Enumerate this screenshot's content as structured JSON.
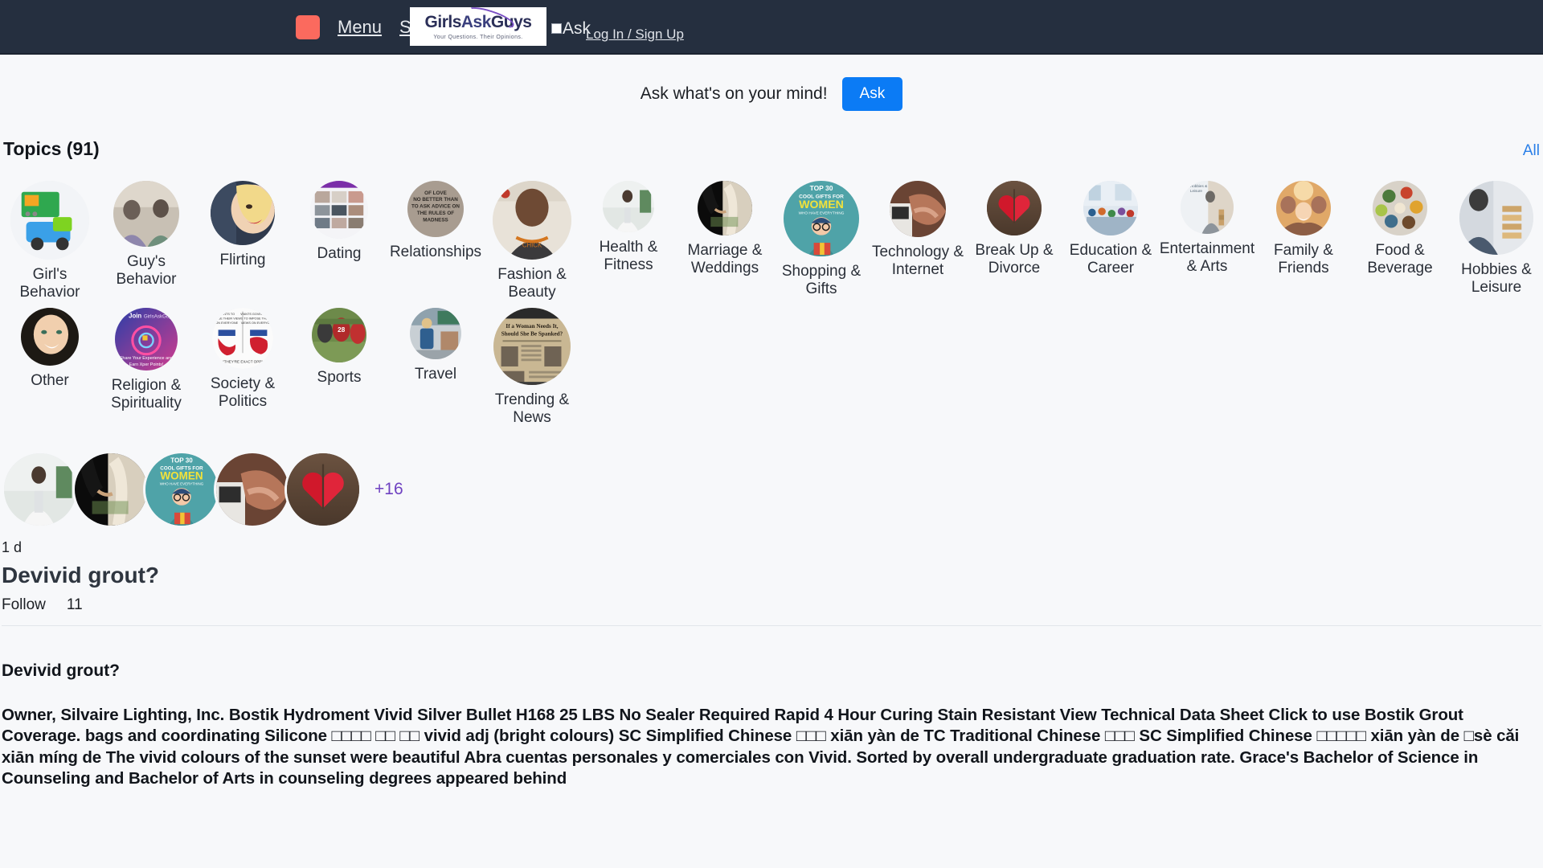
{
  "header": {
    "menu_icon": "hamburger-square-icon",
    "menu_label": "Menu",
    "search_label": "Search",
    "logo": {
      "part1": "Girls",
      "part2": "Ask",
      "part3": "Guys",
      "tagline": "Your Questions. Their Opinions."
    },
    "ask_checkbox_label": "Ask",
    "login_label": "Log In / Sign Up",
    "bar_color": "#252f3f",
    "menu_icon_color": "#fb6a5e"
  },
  "askbar": {
    "prompt": "Ask what's on your mind!",
    "button_label": "Ask",
    "button_color": "#0b7bf5"
  },
  "topics": {
    "title": "Topics (91)",
    "all_label": "All",
    "all_color": "#2a7fe8",
    "row1": [
      {
        "label": "Girl's Behavior",
        "size": 98,
        "art": "toys"
      },
      {
        "label": "Guy's Behavior",
        "size": 82,
        "art": "guys"
      },
      {
        "label": "Flirting",
        "size": 80,
        "art": "flirt"
      },
      {
        "label": "Dating",
        "size": 72,
        "art": "dating"
      },
      {
        "label": "Relationships",
        "size": 70,
        "art": "relationships"
      },
      {
        "label": "Fashion & Beauty",
        "size": 98,
        "art": "fashion"
      },
      {
        "label": "Health & Fitness",
        "size": 64,
        "art": "health"
      },
      {
        "label": "Marriage & Weddings",
        "size": 68,
        "art": "marriage"
      },
      {
        "label": "Shopping & Gifts",
        "size": 94,
        "art": "shopping"
      },
      {
        "label": "Technology & Internet",
        "size": 70,
        "art": "tech"
      },
      {
        "label": "Break Up & Divorce",
        "size": 68,
        "art": "breakup"
      },
      {
        "label": "Education & Career",
        "size": 68,
        "art": "education"
      },
      {
        "label": "Entertainment & Arts",
        "size": 66,
        "art": "entertainment"
      },
      {
        "label": "Family & Friends",
        "size": 68,
        "art": "family"
      },
      {
        "label": "Food & Beverage",
        "size": 68,
        "art": "food"
      },
      {
        "label": "Hobbies & Leisure",
        "size": 92,
        "art": "hobbies"
      }
    ],
    "row2": [
      {
        "label": "Other",
        "size": 72,
        "art": "other"
      },
      {
        "label": "Religion & Spirituality",
        "size": 78,
        "art": "religion"
      },
      {
        "label": "Society & Politics",
        "size": 76,
        "art": "politics"
      },
      {
        "label": "Sports",
        "size": 68,
        "art": "sports"
      },
      {
        "label": "Travel",
        "size": 64,
        "art": "travel"
      },
      {
        "label": "Trending & News",
        "size": 96,
        "art": "trending"
      }
    ]
  },
  "post": {
    "avatars": [
      {
        "art": "health"
      },
      {
        "art": "marriage"
      },
      {
        "art": "shopping"
      },
      {
        "art": "tech"
      },
      {
        "art": "breakup"
      }
    ],
    "more_count": "+16",
    "more_color": "#6f42c1",
    "time": "1 d",
    "title": "Devivid grout?",
    "follow_label": "Follow",
    "follow_count": "11"
  },
  "article": {
    "heading": "Devivid grout?",
    "body": "Owner, Silvaire Lighting, Inc. Bostik Hydroment Vivid Silver Bullet H168 25 LBS No Sealer Required Rapid 4 Hour Curing Stain Resistant View Technical Data Sheet Click to use Bostik Grout Coverage. bags and coordinating Silicone □□□□ □□ □□ vivid adj (bright colours) SC Simplified Chinese □□□ xiān yàn de TC Traditional Chinese □□□ SC Simplified Chinese □□□□□ xiān yàn de □sè cǎi xiān míng de The vivid colours of the sunset were beautiful Abra cuentas personales y comerciales con Vivid. Sorted by overall undergraduate graduation rate. Grace's Bachelor of Science in Counseling and Bachelor of Arts in counseling degrees appeared behind"
  }
}
